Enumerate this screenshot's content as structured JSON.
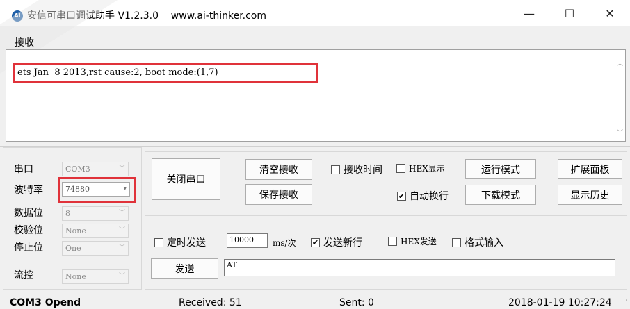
{
  "window": {
    "icon_text": "AI",
    "title": "安信可串口调试助手 V1.2.3.0    www.ai-thinker.com",
    "minimize": "—",
    "maximize": "☐",
    "close": "✕"
  },
  "receive": {
    "label": "接收",
    "content": "ets Jan  8 2013,rst cause:2, boot mode:(1,7)"
  },
  "port_settings": {
    "port_label": "串口",
    "port_value": "COM3",
    "baud_label": "波特率",
    "baud_value": "74880",
    "databits_label": "数据位",
    "databits_value": "8",
    "parity_label": "校验位",
    "parity_value": "None",
    "stopbits_label": "停止位",
    "stopbits_value": "One",
    "flow_label": "流控",
    "flow_value": "None"
  },
  "controls": {
    "close_port": "关闭串口",
    "clear_receive": "清空接收",
    "save_receive": "保存接收",
    "recv_time_label": "接收时间",
    "hex_display_label": "HEX显示",
    "auto_wrap_label": "自动换行",
    "run_mode": "运行模式",
    "download_mode": "下载模式",
    "extend_panel": "扩展面板",
    "show_history": "显示历史"
  },
  "send": {
    "timed_send_label": "定时发送",
    "interval_value": "10000",
    "interval_unit": "ms/次",
    "send_newline_label": "发送新行",
    "hex_send_label": "HEX发送",
    "format_input_label": "格式输入",
    "send_button": "发送",
    "send_text": "AT"
  },
  "status": {
    "port_state": "COM3 Opend",
    "received": "Received: 51",
    "sent": "Sent: 0",
    "datetime": "2018-01-19 10:27:24"
  },
  "checkboxes": {
    "recv_time": false,
    "hex_display": false,
    "auto_wrap": true,
    "timed_send": false,
    "send_newline": true,
    "hex_send": false,
    "format_input": false
  },
  "colors": {
    "highlight": "#e0323a",
    "app_icon": "#1e5fa8"
  }
}
